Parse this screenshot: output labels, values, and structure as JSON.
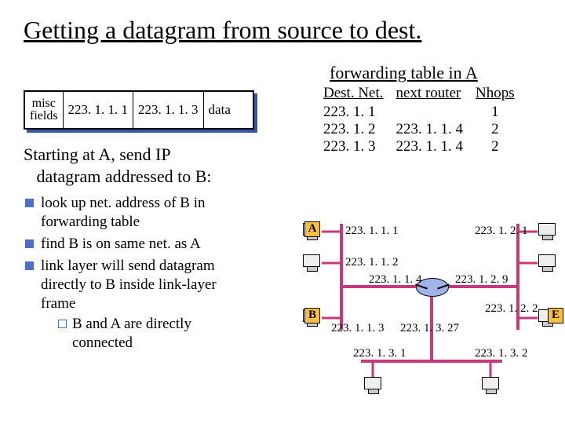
{
  "title": "Getting a datagram from source to dest.",
  "packet": {
    "misc_line1": "misc",
    "misc_line2": "fields",
    "src": "223. 1. 1. 1",
    "dst": "223. 1. 1. 3",
    "data": "data"
  },
  "intro_line1": "Starting at A, send IP",
  "intro_line2": "datagram addressed to B:",
  "bullets": {
    "b0_l1": "look up net. address of B in",
    "b0_l2": "forwarding table",
    "b1": "find B is on same net. as A",
    "b2_l1": "link layer will send datagram",
    "b2_l2": "directly to B inside link-layer",
    "b2_l3": "frame",
    "sub0_l1": "B and A are directly",
    "sub0_l2": "connected"
  },
  "ft": {
    "title": "forwarding table in A",
    "h0": "Dest. Net.",
    "h1": "next router",
    "h2": "Nhops",
    "rows": [
      {
        "net": "223. 1. 1",
        "nr": "",
        "nh": "1"
      },
      {
        "net": "223. 1. 2",
        "nr": "223. 1. 1. 4",
        "nh": "2"
      },
      {
        "net": "223. 1. 3",
        "nr": "223. 1. 1. 4",
        "nh": "2"
      }
    ]
  },
  "diagram": {
    "tagA": "A",
    "tagB": "B",
    "tagE": "E",
    "ip": {
      "a": "223. 1. 1. 1",
      "b": "223. 1. 1. 2",
      "c": "223. 1. 1. 3",
      "d": "223. 1. 1. 4",
      "e": "223. 1. 2. 1",
      "f": "223. 1. 2. 9",
      "g": "223. 1. 2. 2",
      "h": "223. 1. 3. 27",
      "i": "223. 1. 3. 1",
      "j": "223. 1. 3. 2"
    }
  }
}
